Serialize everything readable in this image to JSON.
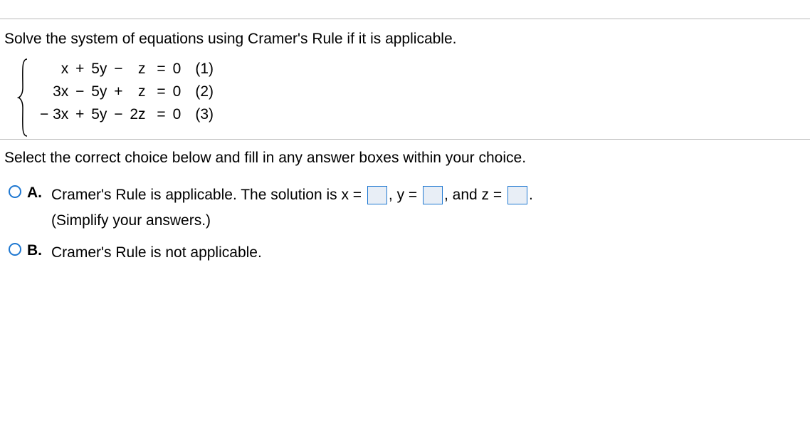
{
  "question": {
    "prompt": "Solve the system of equations using Cramer's Rule if it is applicable.",
    "equations": [
      {
        "x": "x",
        "xop": " + ",
        "y": "5y",
        "yop": " − ",
        "z": "z",
        "eq": " =",
        "rhs": "0",
        "label": "(1)"
      },
      {
        "x": "3x",
        "xop": " − ",
        "y": "5y",
        "yop": " + ",
        "z": "z",
        "eq": " =",
        "rhs": "0",
        "label": "(2)"
      },
      {
        "x": "− 3x",
        "xop": " + ",
        "y": "5y",
        "yop": " − ",
        "z": "2z",
        "eq": " =",
        "rhs": "0",
        "label": "(3)"
      }
    ]
  },
  "answer": {
    "prompt": "Select the correct choice below and fill in any answer boxes within your choice.",
    "choices": {
      "A": {
        "letter": "A.",
        "part1": "Cramer's Rule is applicable. The solution is x = ",
        "sep1": ", y = ",
        "sep2": ", and z = ",
        "end": ".",
        "hint": "(Simplify your answers.)",
        "x_value": "",
        "y_value": "",
        "z_value": ""
      },
      "B": {
        "letter": "B.",
        "text": "Cramer's Rule is not applicable."
      }
    }
  }
}
